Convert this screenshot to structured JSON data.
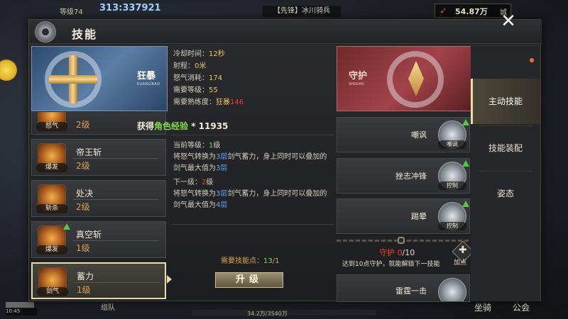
{
  "hud": {
    "level": "等级74",
    "power": "313:337921",
    "target": "【先锋】冰川骑兵",
    "gold": "54.87万",
    "city": "城",
    "team": "组队",
    "exp": "34.2万/3540万",
    "mount": "坐骑",
    "notice": "公会",
    "time": "10:45"
  },
  "panel": {
    "title": "技能",
    "close": "✕"
  },
  "selected_skill": {
    "name": "狂暴",
    "pinyin": "KUANGBAO",
    "cooldown_label": "冷却时间：",
    "cooldown_value": "12秒",
    "range_label": "射程：",
    "range_value": "0米",
    "rage_label": "怒气消耗：",
    "rage_value": "174",
    "req_level_label": "需要等级：",
    "req_level_value": "55",
    "prof_label": "需要熟练度：",
    "prof_name": "狂暴",
    "prof_value": "146"
  },
  "exp_reward": {
    "prefix": "获得",
    "role": "角色经验",
    "amount": " * 11935"
  },
  "current_level": {
    "label": "当前等级：",
    "level": "1",
    "unit": "级",
    "desc_a": "将怒气转换为",
    "desc_b": "3层",
    "desc_c": "剑气蓄力，身上同时可以叠加的",
    "desc_d": "剑气最大值为",
    "desc_e": "3层"
  },
  "next_level": {
    "label": "下一级：",
    "level": "2",
    "unit": "级",
    "desc_a": "将怒气转换为",
    "desc_b": "3层",
    "desc_c": "剑气蓄力，身上同时可以叠加的",
    "desc_d": "剑气最大值为",
    "desc_e": "4层"
  },
  "skill_points": {
    "label": "需要技能点：",
    "have": "13",
    "sep": "/",
    "need": "1"
  },
  "upgrade_button": "升级",
  "skill_list": [
    {
      "name": "",
      "level": "2级",
      "tag": "怒气"
    },
    {
      "name": "帝王斩",
      "level": "2级",
      "tag": "爆发"
    },
    {
      "name": "处决",
      "level": "2级",
      "tag": "斩杀"
    },
    {
      "name": "真空斩",
      "level": "1级",
      "tag": "爆发"
    },
    {
      "name": "蓄力",
      "level": "1级",
      "tag": "剑气"
    }
  ],
  "right_banner": {
    "name": "守护",
    "pinyin": "SHOUHU"
  },
  "right_slots": [
    {
      "name": "嘲讽",
      "tag": "嘲讽"
    },
    {
      "name": "挫志冲锋",
      "tag": "控制"
    },
    {
      "name": "踢晕",
      "tag": "控制"
    },
    {
      "name": "雷霆一击",
      "tag": ""
    }
  ],
  "unlock": {
    "title": "守护",
    "count": "0",
    "total": "/10",
    "desc": "达到10点守护，就能解锁下一技能",
    "add": "加点"
  },
  "tabs": [
    {
      "label": "主动技能"
    },
    {
      "label": "技能装配"
    },
    {
      "label": "姿态"
    }
  ],
  "colors": {
    "accent": "#e8dca8",
    "skill_level": "#d9a44a",
    "highlight_red": "#ff3b30",
    "highlight_blue": "#5fa3ff",
    "highlight_green": "#7ad85a"
  }
}
